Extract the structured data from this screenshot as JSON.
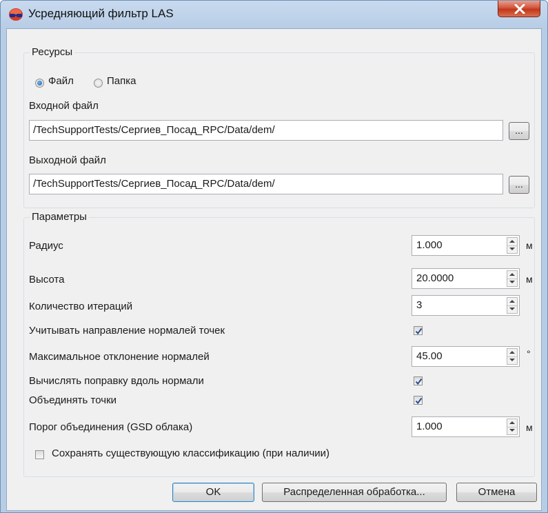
{
  "window": {
    "title": "Усредняющий фильтр LAS",
    "close_glyph": "X"
  },
  "resources": {
    "group_title": "Ресурсы",
    "radio_file": "Файл",
    "radio_folder": "Папка",
    "selected": "Файл",
    "input_label": "Входной файл",
    "input_value": "/TechSupportTests/Сергиев_Посад_RPC/Data/dem/",
    "output_label": "Выходной файл",
    "output_value": "/TechSupportTests/Сергиев_Посад_RPC/Data/dem/",
    "browse_label": "..."
  },
  "params": {
    "group_title": "Параметры",
    "radius_label": "Радиус",
    "radius_value": "1.000",
    "radius_unit": "м",
    "height_label": "Высота",
    "height_value": "20.0000",
    "height_unit": "м",
    "iterations_label": "Количество итераций",
    "iterations_value": "3",
    "normals_dir_label": "Учитывать направление нормалей точек",
    "normals_dir_checked": true,
    "max_dev_label": "Максимальное отклонение нормалей",
    "max_dev_value": "45.00",
    "max_dev_unit": "°",
    "correction_label": "Вычислять поправку вдоль нормали",
    "correction_checked": true,
    "merge_label": "Объединять точки",
    "merge_checked": true,
    "merge_threshold_label": "Порог объединения (GSD облака)",
    "merge_threshold_value": "1.000",
    "merge_threshold_unit": "м",
    "keep_class_label": "Сохранять существующую классификацию (при наличии)",
    "keep_class_checked": false
  },
  "buttons": {
    "ok": "OK",
    "distributed": "Распределенная обработка...",
    "cancel": "Отмена"
  },
  "colors": {
    "titlebar": "#b7cde6",
    "close_red": "#c1371d",
    "dialog_bg": "#f0f0f0",
    "checkmark": "#2a4d8f"
  },
  "icons": {
    "app": "glasses-app-icon",
    "close": "close-icon",
    "spin_up": "spin-up-icon",
    "spin_down": "spin-down-icon",
    "check": "checkmark-icon"
  }
}
